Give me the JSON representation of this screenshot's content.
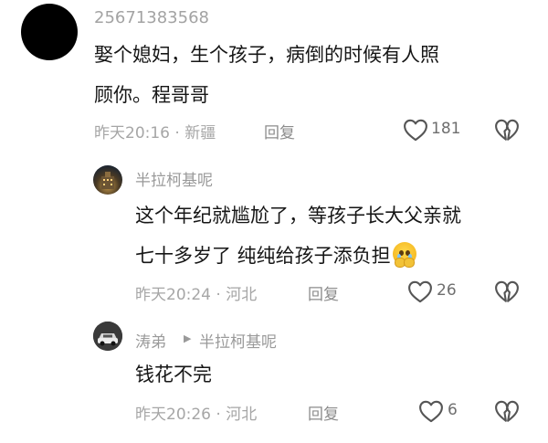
{
  "comments": [
    {
      "username": "25671383568",
      "lines": [
        "娶个媳妇，生个孩子，病倒的时候有人照",
        "顾你。程哥哥"
      ],
      "time_location": "昨天20:16 · 新疆",
      "reply_label": "回复",
      "likes": "181",
      "avatar": "black-circle-avatar"
    },
    {
      "username": "半拉柯基呢",
      "lines": [
        "这个年纪就尴尬了，等孩子长大父亲就",
        "七十多岁了 纯纯给孩子添负担"
      ],
      "emoji": "pleading-face-emoji",
      "time_location": "昨天20:24 · 河北",
      "reply_label": "回复",
      "likes": "26",
      "avatar": "night-building-avatar"
    },
    {
      "username": "涛弟",
      "reply_to": "半拉柯基呢",
      "lines": [
        "钱花不完"
      ],
      "time_location": "昨天20:26 · 河北",
      "reply_label": "回复",
      "likes": "6",
      "avatar": "car-avatar"
    }
  ],
  "icons": {
    "like": "heart-outline-icon",
    "dislike": "broken-heart-icon",
    "reply_arrow": "triangle-right-icon"
  }
}
